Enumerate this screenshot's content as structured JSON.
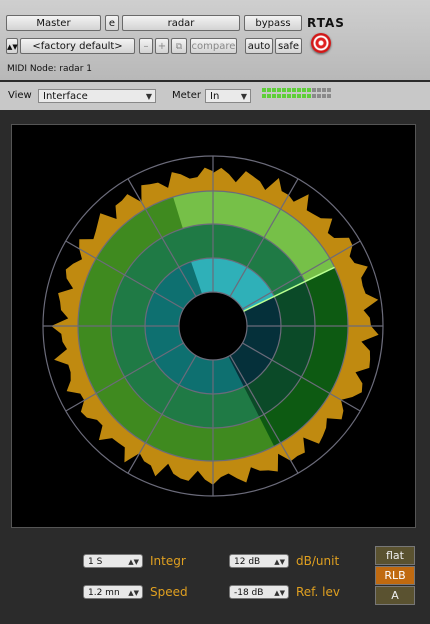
{
  "host": {
    "master_label": "Master",
    "e_label": "e",
    "plugin_name": "radar",
    "bypass_label": "bypass",
    "format_label": "RTAS",
    "preset": "<factory default>",
    "minus_label": "–",
    "plus_label": "+",
    "compare_label": "compare",
    "auto_label": "auto",
    "safe_label": "safe",
    "midi_node": "MIDI Node: radar 1"
  },
  "viewbar": {
    "view_label": "View",
    "view_value": "Interface",
    "meter_label": "Meter",
    "meter_value": "In",
    "meter_levels": [
      0.7,
      0.7
    ]
  },
  "controls": {
    "integr_value": "1 S",
    "integr_label": "Integr",
    "speed_value": "1.2 mn",
    "speed_label": "Speed",
    "dbunit_value": "12 dB",
    "dbunit_label": "dB/unit",
    "reflev_value": "-18 dB",
    "reflev_label": "Ref. lev",
    "weighting": [
      "flat",
      "RLB",
      "A"
    ],
    "weighting_selected": "RLB"
  },
  "colors": {
    "accent": "#e0a020",
    "selected_weight": "#c06a10",
    "panel_bg": "#000000"
  }
}
